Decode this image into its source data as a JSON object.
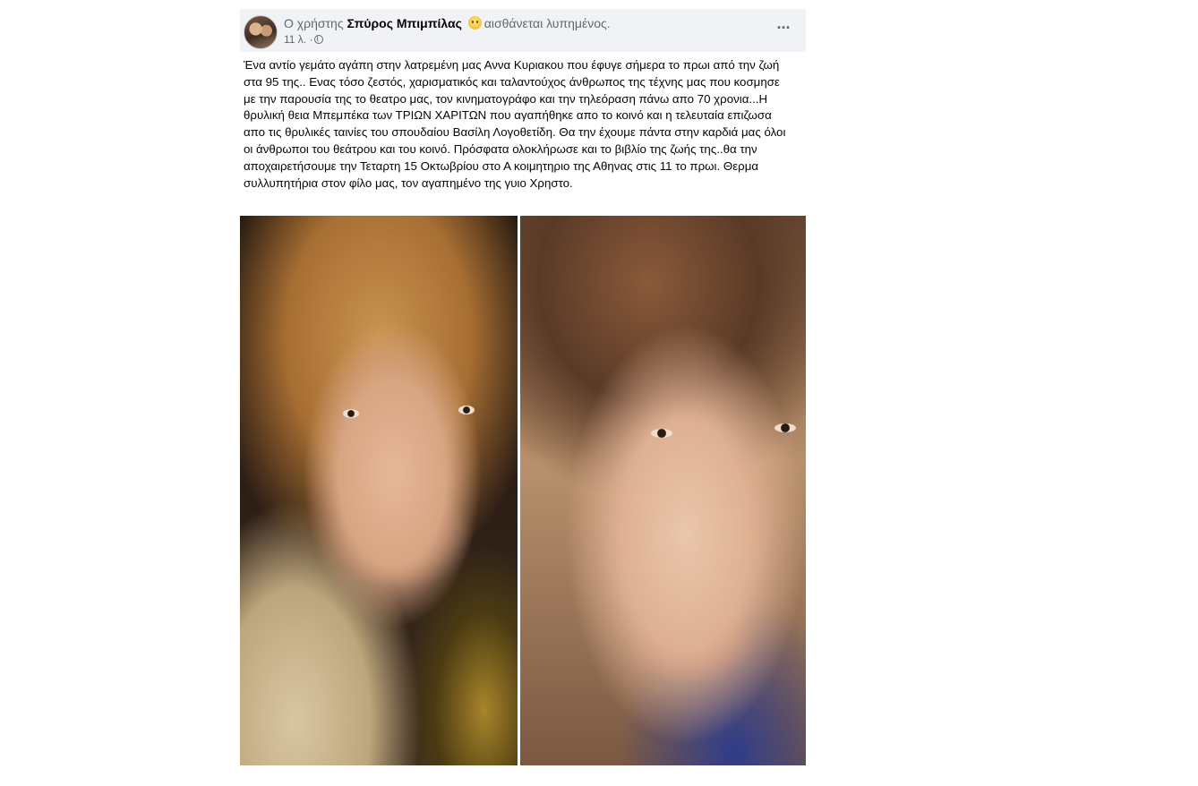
{
  "post": {
    "author_prefix": "Ο χρήστης",
    "author_name": "Σπύρος Μπιμπίλας",
    "feeling_text": "αισθάνεται λυπημένος.",
    "feeling_icon": "sad-face-emoji",
    "time": "11 λ. ·",
    "privacy_icon": "globe-icon",
    "more_label": "···",
    "text": "Ένα αντίο γεμάτο αγάπη στην λατρεμένη μας Αννα Κυριακου που έφυγε σήμερα  το πρωι από την ζωή στα 95 της..  Ενας τόσο ζεστός, χαρισματικός και ταλαντούχος άνθρωπος της τέχνης μας που κοσμησε με την παρουσία της το θεατρο μας, τον κινηματογράφο και την τηλεόραση πάνω απο 70 χρονια...Η θρυλική θεια Μπεμπέκα των ΤΡΙΩΝ ΧΑΡΙΤΩΝ που αγαπήθηκε απο το κοινό και η τελευταία επιζωσα απο τις θρυλικές ταινίες του σπουδαίου Βασίλη Λογοθετίδη. Θα την έχουμε πάντα στην καρδιά μας όλοι οι άνθρωποι του θεάτρου και του κοινό. Πρόσφατα ολοκλήρωσε και το βιβλίο της ζωής της..θα την αποχαιρετήσουμε την Τεταρτη 15 Οκτωβρίου στο Α κοιμητηριο της Αθηνας στις 11 το πρωι. Θερμα συλλυπητήρια στον φίλο μας, τον αγαπημένο της γυιο Χρηστο."
  }
}
